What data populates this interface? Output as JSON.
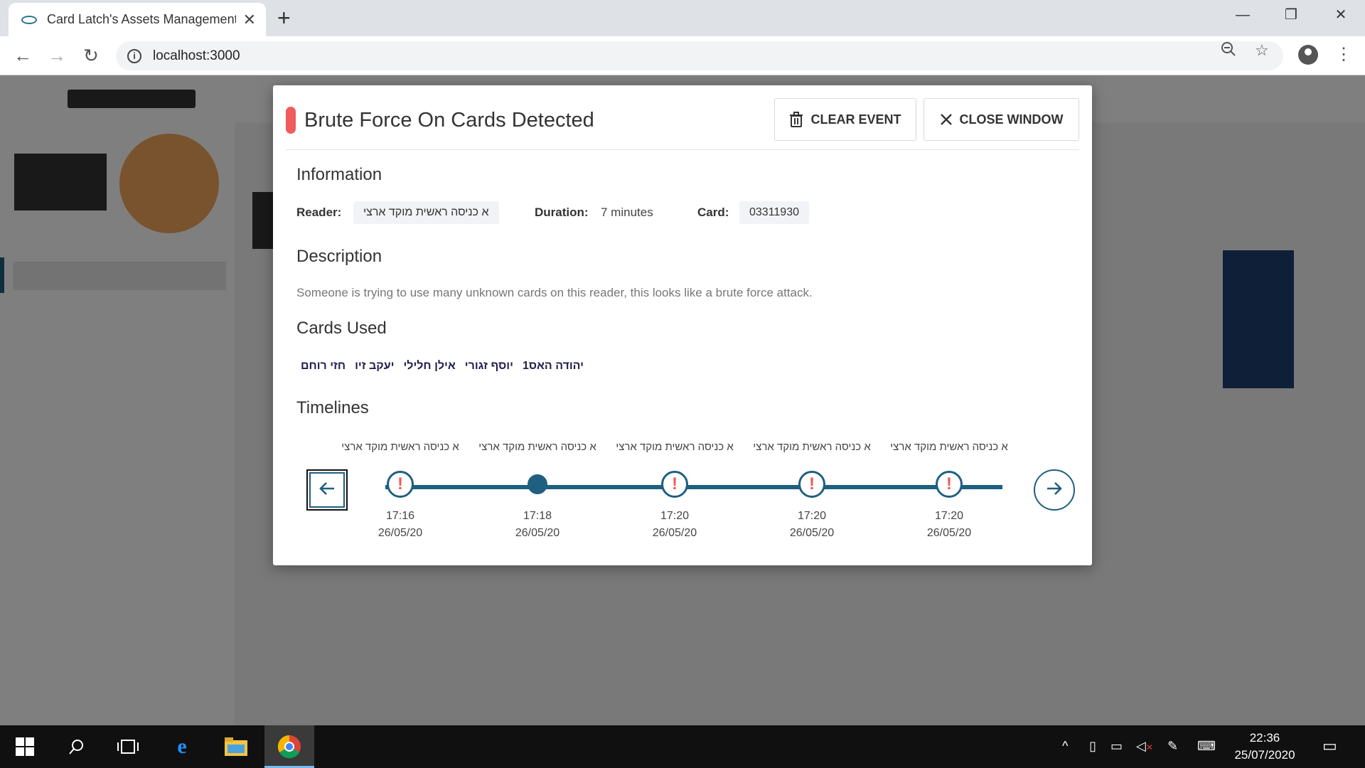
{
  "browser": {
    "tab_title": "Card Latch's Assets Management",
    "url": "localhost:3000"
  },
  "modal": {
    "title": "Brute Force On Cards Detected",
    "severity_color": "#f05b5b",
    "clear_label": "CLEAR EVENT",
    "close_label": "CLOSE WINDOW",
    "information": {
      "heading": "Information",
      "reader_label": "Reader",
      "reader_value": "א כניסה ראשית מוקד ארצי",
      "duration_label": "Duration",
      "duration_value": "7 minutes",
      "card_label": "Card",
      "card_value": "03311930"
    },
    "description": {
      "heading": "Description",
      "text": "Someone is trying to use many unknown cards on this reader, this looks like a brute force attack."
    },
    "cards_used": {
      "heading": "Cards Used",
      "names": [
        "יהודה האס1",
        "יוסף זגורי",
        "אילן חלילי",
        "יעקב זיו",
        "חזי רוחם"
      ]
    },
    "timelines": {
      "heading": "Timelines",
      "accent_color": "#1f5f80",
      "events": [
        {
          "reader": "א כניסה ראשית מוקד ארצי",
          "time": "17:16",
          "date": "26/05/20",
          "alert": true
        },
        {
          "reader": "א כניסה ראשית מוקד ארצי",
          "time": "17:18",
          "date": "26/05/20",
          "alert": false
        },
        {
          "reader": "א כניסה ראשית מוקד ארצי",
          "time": "17:20",
          "date": "26/05/20",
          "alert": true
        },
        {
          "reader": "א כניסה ראשית מוקד ארצי",
          "time": "17:20",
          "date": "26/05/20",
          "alert": true
        },
        {
          "reader": "א כניסה ראשית מוקד ארצי",
          "time": "17:20",
          "date": "26/05/20",
          "alert": true
        }
      ]
    }
  },
  "taskbar": {
    "time": "22:36",
    "date": "25/07/2020"
  }
}
